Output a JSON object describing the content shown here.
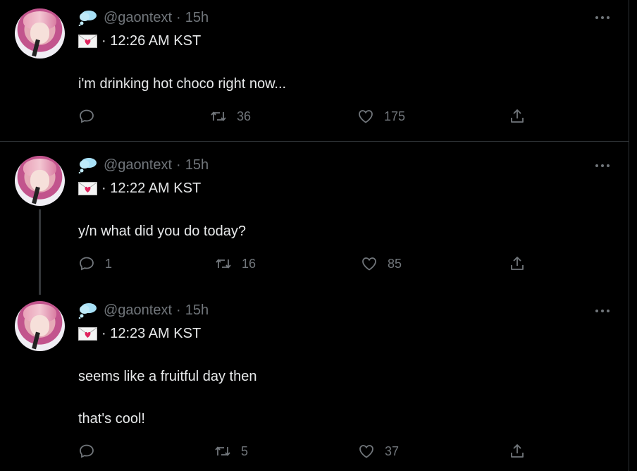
{
  "tweets": [
    {
      "handle": "@gaontext",
      "sep": "·",
      "age": "15h",
      "time": "· 12:26 AM KST",
      "lines": [
        "i'm drinking hot choco right now..."
      ],
      "replies": "",
      "retweets": "36",
      "likes": "175"
    },
    {
      "handle": "@gaontext",
      "sep": "·",
      "age": "15h",
      "time": "· 12:22 AM KST",
      "lines": [
        "y/n what did you do today?"
      ],
      "replies": "1",
      "retweets": "16",
      "likes": "85"
    },
    {
      "handle": "@gaontext",
      "sep": "·",
      "age": "15h",
      "time": "· 12:23 AM KST",
      "lines": [
        "seems like a fruitful day then",
        "that's cool!"
      ],
      "replies": "",
      "retweets": "5",
      "likes": "37"
    }
  ],
  "icons": {
    "reply": "reply-icon",
    "retweet": "retweet-icon",
    "like": "heart-icon",
    "share": "share-icon",
    "more": "more-icon",
    "cloud": "cloud-emoji-icon",
    "envelope": "love-letter-emoji-icon"
  },
  "colors": {
    "background": "#000000",
    "text": "#e7e9ea",
    "muted": "#71767b",
    "border": "#2f3336"
  }
}
